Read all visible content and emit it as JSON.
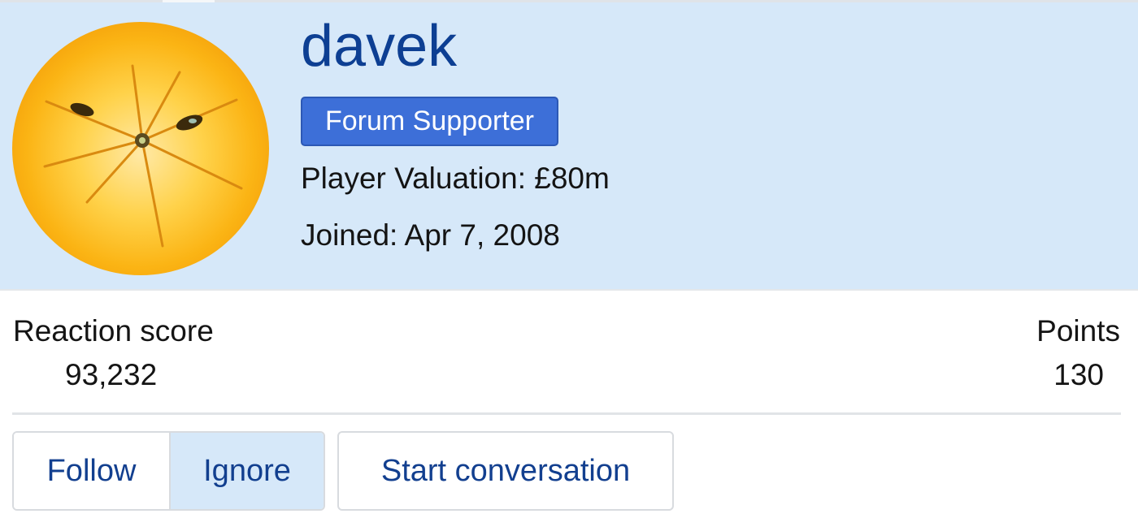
{
  "profile": {
    "username": "davek",
    "badge": "Forum Supporter",
    "valuation": "Player Valuation: £80m",
    "joined": "Joined: Apr 7, 2008",
    "avatar_icon": "orange-face-avatar"
  },
  "stats": {
    "reaction_label": "Reaction score",
    "reaction_value": "93,232",
    "points_label": "Points",
    "points_value": "130"
  },
  "actions": {
    "follow": "Follow",
    "ignore": "Ignore",
    "start_conversation": "Start conversation"
  },
  "colors": {
    "header_bg": "#d6e8f9",
    "username": "#0d3f93",
    "badge_bg": "#3d6fd8",
    "button_text": "#123f8f"
  }
}
